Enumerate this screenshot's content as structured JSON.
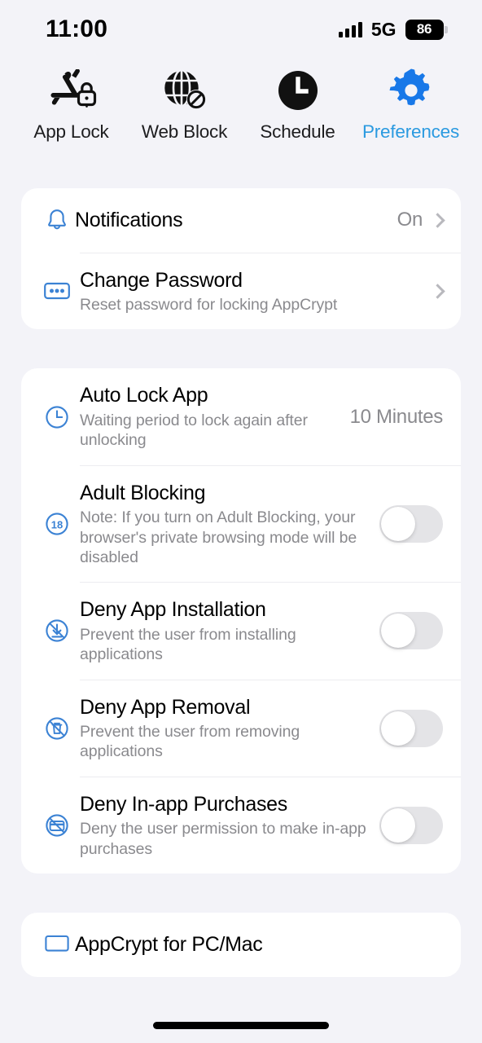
{
  "status_bar": {
    "time": "11:00",
    "network": "5G",
    "battery_percent": "86",
    "signal_icon": "cellular-signal-icon",
    "battery_icon": "battery-icon"
  },
  "tabs": [
    {
      "label": "App Lock",
      "icon": "app-lock-icon",
      "active": false
    },
    {
      "label": "Web Block",
      "icon": "web-block-icon",
      "active": false
    },
    {
      "label": "Schedule",
      "icon": "schedule-icon",
      "active": false
    },
    {
      "label": "Preferences",
      "icon": "preferences-gear-icon",
      "active": true
    }
  ],
  "sections": [
    {
      "rows": [
        {
          "title": "Notifications",
          "subtitle": "",
          "value": "On",
          "icon": "bell-icon",
          "accessory": "chevron"
        },
        {
          "title": "Change Password",
          "subtitle": "Reset password for locking AppCrypt",
          "value": "",
          "icon": "password-dots-icon",
          "accessory": "chevron"
        }
      ]
    },
    {
      "rows": [
        {
          "title": "Auto Lock App",
          "subtitle": "Waiting period to lock again after unlocking",
          "value": "10 Minutes",
          "icon": "clock-icon",
          "accessory": "value"
        },
        {
          "title": "Adult Blocking",
          "subtitle": "Note: If you turn on Adult Blocking, your browser's private browsing mode will be disabled",
          "value": "",
          "icon": "age-18-icon",
          "accessory": "toggle",
          "toggle_on": false
        },
        {
          "title": "Deny App Installation",
          "subtitle": "Prevent the user from installing applications",
          "value": "",
          "icon": "deny-install-icon",
          "accessory": "toggle",
          "toggle_on": false
        },
        {
          "title": "Deny App Removal",
          "subtitle": "Prevent the user from removing applications",
          "value": "",
          "icon": "deny-trash-icon",
          "accessory": "toggle",
          "toggle_on": false
        },
        {
          "title": "Deny In-app Purchases",
          "subtitle": "Deny the user permission to make in-app purchases",
          "value": "",
          "icon": "deny-card-icon",
          "accessory": "toggle",
          "toggle_on": false
        }
      ]
    },
    {
      "rows": [
        {
          "title": "AppCrypt for PC/Mac",
          "subtitle": "",
          "value": "",
          "icon": "monitor-icon",
          "accessory": "none"
        }
      ]
    }
  ],
  "colors": {
    "accent_blue": "#2b9ae0",
    "icon_blue": "#3b82d4",
    "page_background": "#f3f3f8",
    "card_background": "#ffffff",
    "secondary_text": "#8a8a8e",
    "toggle_off_track": "#e4e4e7"
  }
}
